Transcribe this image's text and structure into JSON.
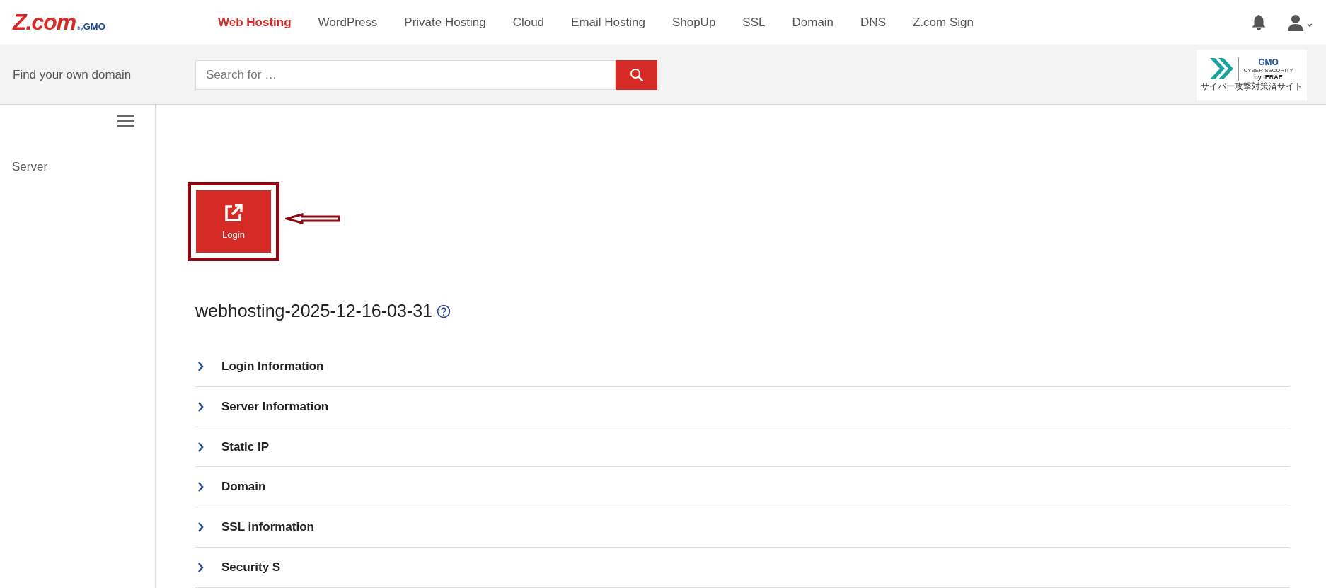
{
  "logo": {
    "main": "Z.com",
    "by": "by",
    "brand": "GMO"
  },
  "nav": [
    {
      "label": "Web Hosting",
      "selected": true
    },
    {
      "label": "WordPress",
      "selected": false
    },
    {
      "label": "Private Hosting",
      "selected": false
    },
    {
      "label": "Cloud",
      "selected": false
    },
    {
      "label": "Email Hosting",
      "selected": false
    },
    {
      "label": "ShopUp",
      "selected": false
    },
    {
      "label": "SSL",
      "selected": false
    },
    {
      "label": "Domain",
      "selected": false
    },
    {
      "label": "DNS",
      "selected": false
    },
    {
      "label": "Z.com Sign",
      "selected": false
    }
  ],
  "domain_search": {
    "label": "Find your own domain",
    "placeholder": "Search for …"
  },
  "security_badge": {
    "brand": "GMO",
    "line1": "CYBER SECURITY",
    "line2": "by IERAE",
    "note": "サイバー攻撃対策済サイト"
  },
  "sidebar": {
    "items": [
      {
        "label": "Server"
      }
    ]
  },
  "login_button": {
    "label": "Login",
    "highlighted": true
  },
  "server": {
    "title": "webhosting-2025-12-16-03-31"
  },
  "sections": [
    {
      "label": "Login Information",
      "expanded": false
    },
    {
      "label": "Server Information",
      "expanded": false
    },
    {
      "label": "Static IP",
      "expanded": false
    },
    {
      "label": "Domain",
      "expanded": false
    },
    {
      "label": "SSL information",
      "expanded": false
    },
    {
      "label": "Security S",
      "expanded": false
    }
  ]
}
